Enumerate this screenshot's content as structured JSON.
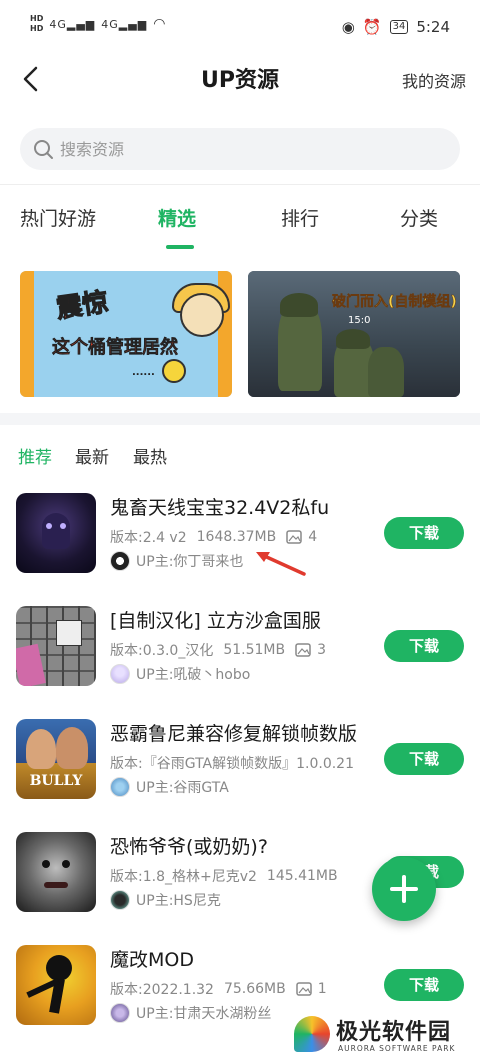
{
  "status_bar": {
    "hd_labels": [
      "HD",
      "HD"
    ],
    "signal_labels": [
      "4G",
      "4G"
    ],
    "battery": "34",
    "time": "5:24"
  },
  "header": {
    "title": "UP资源",
    "right_link": "我的资源"
  },
  "search": {
    "placeholder": "搜索资源"
  },
  "tabs": [
    {
      "label": "热门好游"
    },
    {
      "label": "精选"
    },
    {
      "label": "排行"
    },
    {
      "label": "分类"
    }
  ],
  "active_tab": "精选",
  "banners": [
    {
      "title": "震惊",
      "subtitle": "这个桶管理居然",
      "dots": "......"
    },
    {
      "title": "破门而入(自制模组)",
      "subtitle": "15:0"
    }
  ],
  "subtabs": [
    {
      "label": "推荐"
    },
    {
      "label": "最新"
    },
    {
      "label": "最热"
    }
  ],
  "active_subtab": "推荐",
  "items": [
    {
      "name": "鬼畜天线宝宝32.4V2私fu",
      "version": "版本:2.4 v2",
      "size": "1648.37MB",
      "images": "4",
      "up": "UP主:你丁哥来也",
      "button": "下载"
    },
    {
      "name": "[自制汉化] 立方沙盒国服",
      "version": "版本:0.3.0_汉化",
      "size": "51.51MB",
      "images": "3",
      "up": "UP主:吼破丶hobo",
      "button": "下载"
    },
    {
      "name": "恶霸鲁尼兼容修复解锁帧数版",
      "version": "版本:『谷雨GTA解锁帧数版』1.0.0.21",
      "size": "",
      "images": "",
      "up": "UP主:谷雨GTA",
      "button": "下载"
    },
    {
      "name": "恐怖爷爷(或奶奶)?",
      "version": "版本:1.8_格林+尼克v2",
      "size": "145.41MB",
      "images": "",
      "up": "UP主:HS尼克",
      "button": "下载"
    },
    {
      "name": "魔改MOD",
      "version": "版本:2022.1.32",
      "size": "75.66MB",
      "images": "1",
      "up": "UP主:甘肃天水湖粉丝",
      "button": "下载"
    }
  ],
  "watermark": {
    "cn": "极光软件园",
    "en": "AURORA SOFTWARE PARK"
  },
  "colors": {
    "accent": "#1fb463",
    "text": "#1a1a1a",
    "muted": "#888888"
  }
}
